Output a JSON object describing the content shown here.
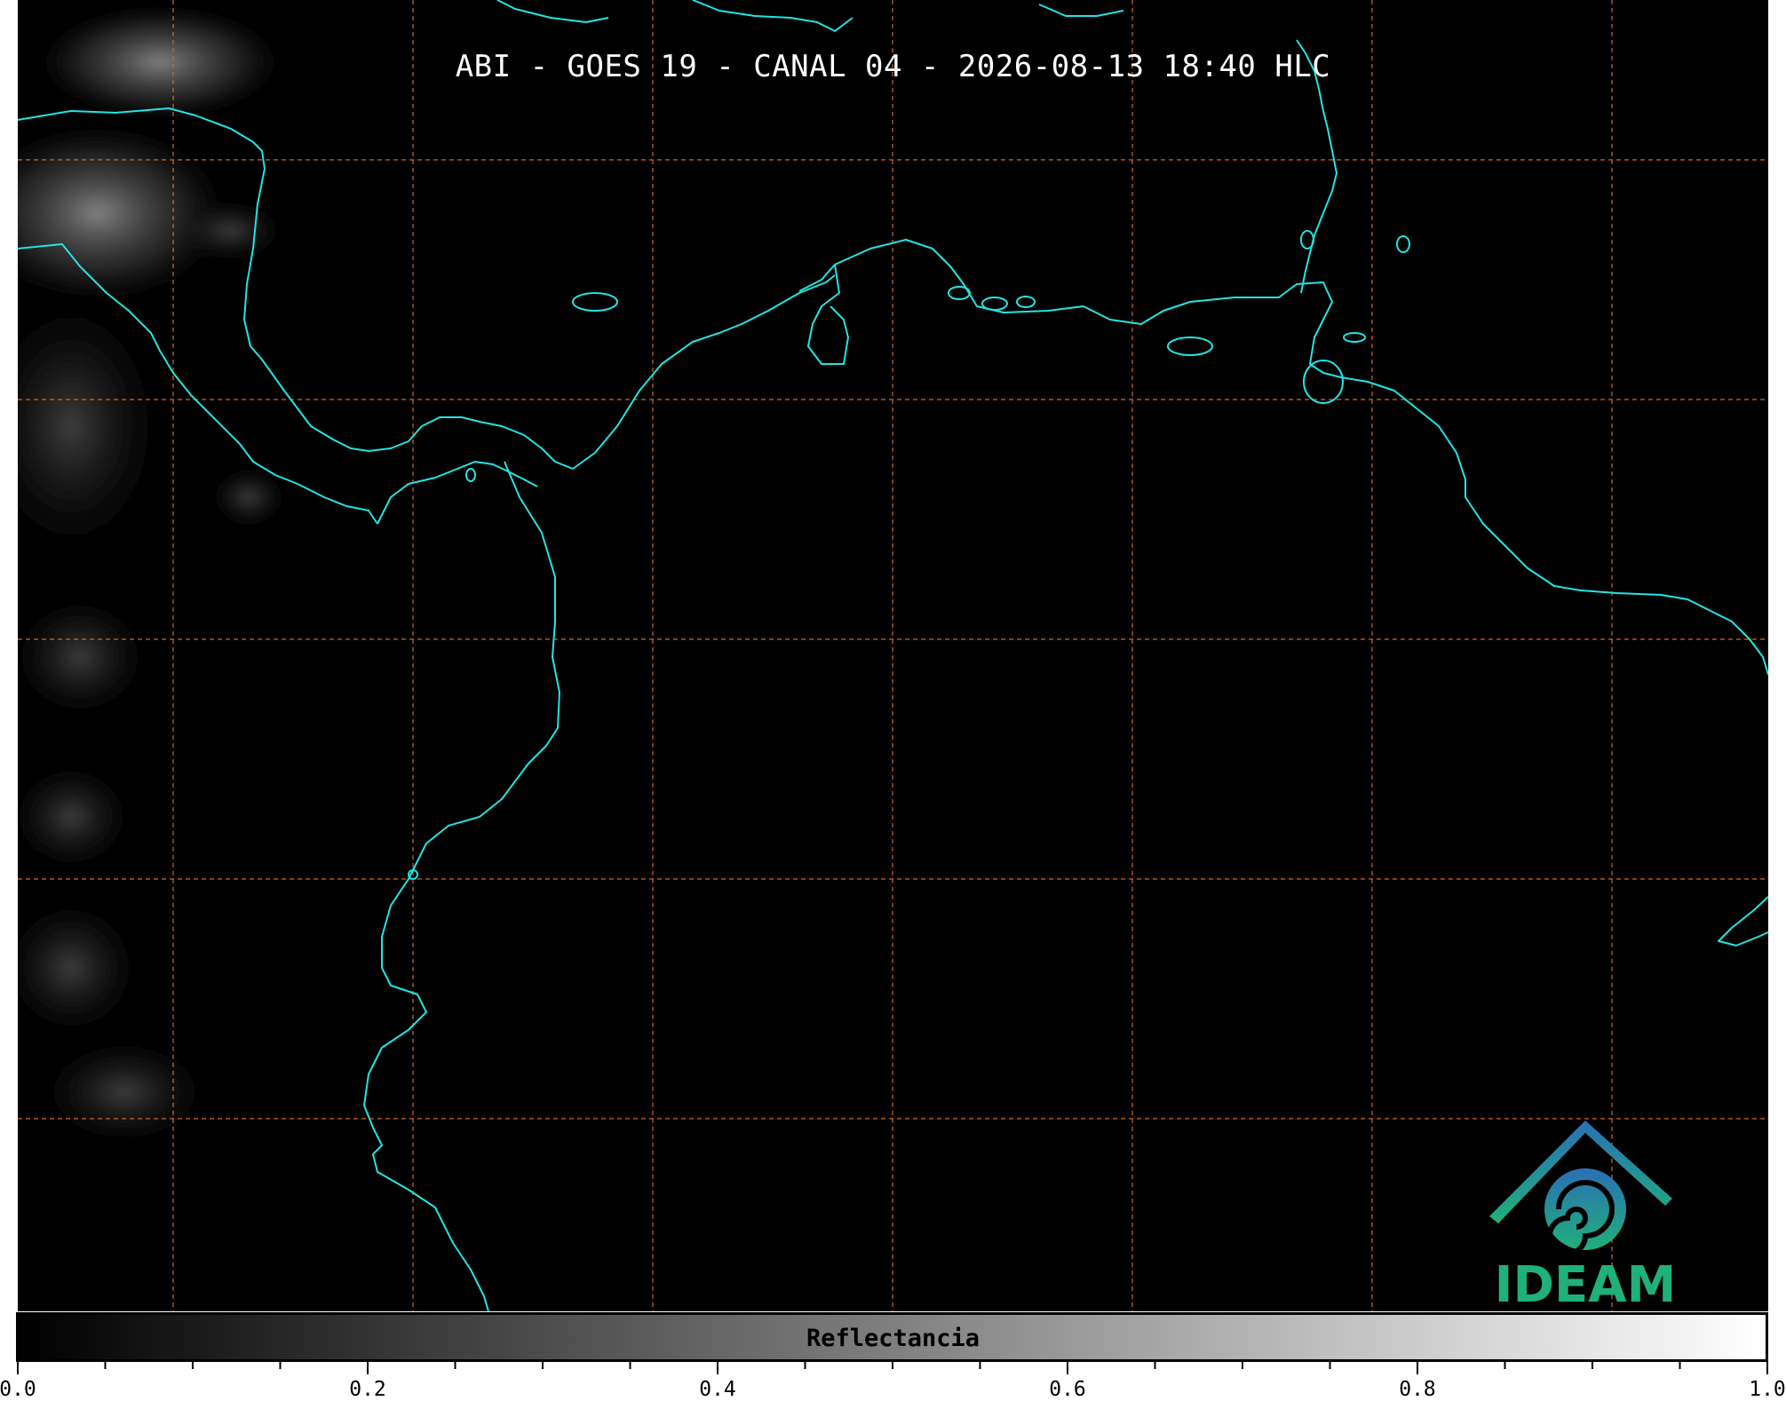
{
  "title": "ABI - GOES 19 - CANAL 04 - 2026-08-13 18:40 HLC",
  "colors": {
    "background": "#000000",
    "coastline": "#22e4e4",
    "gridlines": "#d2691e",
    "logo_top": "#2a6fb5",
    "logo_bottom": "#20b07a"
  },
  "logo": {
    "text": "IDEAM",
    "icon": "ideam-logo-icon"
  },
  "colorbar": {
    "label": "Reflectancia",
    "colormap": "gray",
    "range": [
      0.0,
      1.0
    ],
    "tick_labels": [
      "0.0",
      "0.2",
      "0.4",
      "0.6",
      "0.8",
      "1.0"
    ],
    "minor_ticks": 20
  },
  "map": {
    "type": "satellite-imagery",
    "gridlines": true,
    "gridline_style": "dashed",
    "features": [
      "coastlines",
      "cloud-cover-west"
    ]
  }
}
